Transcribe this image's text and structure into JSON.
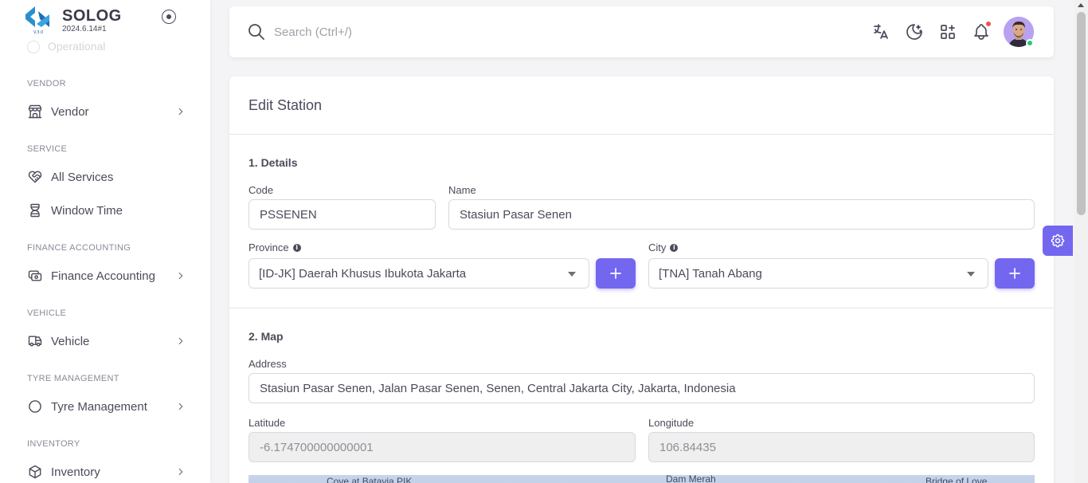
{
  "brand": {
    "name": "SOLOG",
    "version": "2024.6.14#1",
    "logo_text": "V.3.0"
  },
  "sidebar": {
    "ghost_item": "Operational",
    "sections": [
      {
        "label": "VENDOR",
        "items": [
          {
            "label": "Vendor",
            "icon": "store-icon",
            "has_children": true
          }
        ]
      },
      {
        "label": "SERVICE",
        "items": [
          {
            "label": "All Services",
            "icon": "heart-handshake-icon",
            "has_children": false
          },
          {
            "label": "Window Time",
            "icon": "hourglass-icon",
            "has_children": false
          }
        ]
      },
      {
        "label": "FINANCE ACCOUNTING",
        "items": [
          {
            "label": "Finance Accounting",
            "icon": "cash-icon",
            "has_children": true
          }
        ]
      },
      {
        "label": "VEHICLE",
        "items": [
          {
            "label": "Vehicle",
            "icon": "truck-icon",
            "has_children": true
          }
        ]
      },
      {
        "label": "TYRE MANAGEMENT",
        "items": [
          {
            "label": "Tyre Management",
            "icon": "circle-icon",
            "has_children": true
          }
        ]
      },
      {
        "label": "INVENTORY",
        "items": [
          {
            "label": "Inventory",
            "icon": "box-icon",
            "has_children": true
          }
        ]
      }
    ]
  },
  "topbar": {
    "search_placeholder": "Search (Ctrl+/)",
    "icons": [
      "translate-icon",
      "moon-icon",
      "apps-add-icon",
      "bell-icon"
    ],
    "has_notification": true,
    "accent": "#7367f0"
  },
  "page": {
    "title": "Edit Station",
    "details": {
      "heading": "1. Details",
      "code_label": "Code",
      "code_value": "PSSENEN",
      "name_label": "Name",
      "name_value": "Stasiun Pasar Senen",
      "province_label": "Province",
      "province_value": "[ID-JK] Daerah Khusus Ibukota Jakarta",
      "city_label": "City",
      "city_value": "[TNA] Tanah Abang"
    },
    "map": {
      "heading": "2. Map",
      "address_label": "Address",
      "address_value": "Stasiun Pasar Senen, Jalan Pasar Senen, Senen, Central Jakarta City, Jakarta, Indonesia",
      "latitude_label": "Latitude",
      "latitude_value": "-6.174700000000001",
      "longitude_label": "Longitude",
      "longitude_value": "106.84435",
      "map_labels": [
        "Cove at Batavia PIK",
        "Dam Merah",
        "Bridge of Love"
      ]
    }
  }
}
